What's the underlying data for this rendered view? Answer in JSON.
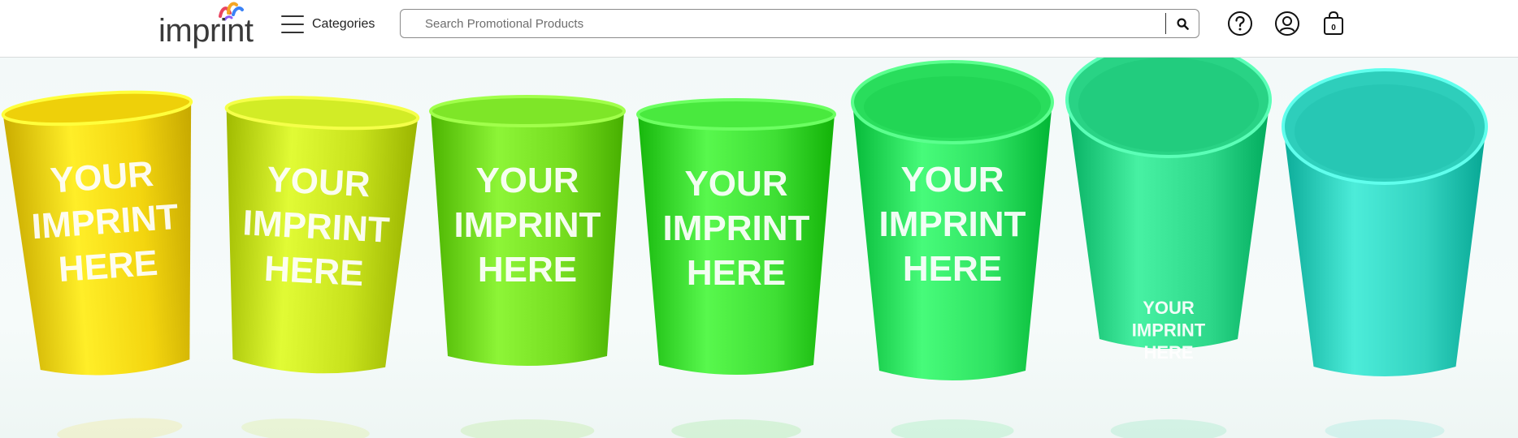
{
  "header": {
    "logo_text": "imprint",
    "categories_label": "Categories",
    "search": {
      "placeholder": "Search Promotional Products",
      "value": ""
    },
    "cart_count": "0",
    "icons": [
      "help-icon",
      "account-icon",
      "cart-icon",
      "search-icon",
      "hamburger-menu-icon"
    ]
  },
  "hero": {
    "cups": [
      {
        "color": "#f3d50f",
        "imprint": [
          "YOUR",
          "IMPRINT",
          "HERE"
        ]
      },
      {
        "color": "#c8e21c",
        "imprint": [
          "YOUR",
          "IMPRINT",
          "HERE"
        ]
      },
      {
        "color": "#74dc1e",
        "imprint": [
          "YOUR",
          "IMPRINT",
          "HERE"
        ]
      },
      {
        "color": "#3fdf34",
        "imprint": [
          "YOUR",
          "IMPRINT",
          "HERE"
        ]
      },
      {
        "color": "#2ee261",
        "imprint": [
          "YOUR",
          "IMPRINT",
          "HERE"
        ]
      },
      {
        "color": "#2ed88a",
        "imprint": [
          "YOUR",
          "IMPRINT",
          "HERE"
        ]
      },
      {
        "color": "#33d3c0",
        "imprint": []
      }
    ]
  }
}
